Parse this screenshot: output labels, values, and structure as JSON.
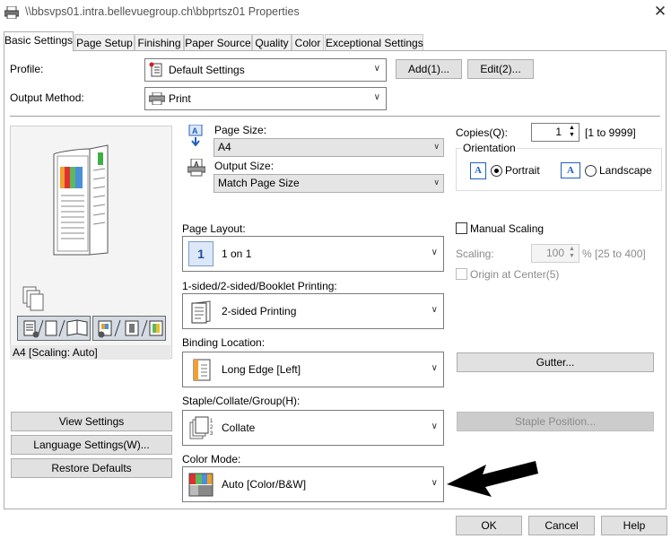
{
  "window": {
    "title": "\\\\bbsvps01.intra.bellevuegroup.ch\\bbprtsz01 Properties",
    "close_glyph": "✕"
  },
  "tabs": [
    {
      "label": "Basic Settings"
    },
    {
      "label": "Page Setup"
    },
    {
      "label": "Finishing"
    },
    {
      "label": "Paper Source"
    },
    {
      "label": "Quality"
    },
    {
      "label": "Color"
    },
    {
      "label": "Exceptional Settings"
    }
  ],
  "profile": {
    "label": "Profile:",
    "value": "Default Settings",
    "add_label": "Add(1)...",
    "edit_label": "Edit(2)..."
  },
  "output_method": {
    "label": "Output Method:",
    "value": "Print"
  },
  "preview": {
    "caption": "A4 [Scaling: Auto]"
  },
  "page_size": {
    "label": "Page Size:",
    "value": "A4"
  },
  "output_size": {
    "label": "Output Size:",
    "value": "Match Page Size"
  },
  "copies": {
    "label": "Copies(Q):",
    "value": "1",
    "range": "[1 to 9999]"
  },
  "orientation": {
    "group_label": "Orientation",
    "portrait_label": "Portrait",
    "landscape_label": "Landscape",
    "selected": "Portrait",
    "icon_letter": "A"
  },
  "page_layout": {
    "label": "Page Layout:",
    "value": "1 on 1",
    "icon_text": "1"
  },
  "manual_scaling": {
    "label": "Manual Scaling",
    "checked": false
  },
  "scaling": {
    "label": "Scaling:",
    "value": "100",
    "range": "% [25 to 400]"
  },
  "origin_center": {
    "label": "Origin at Center(5)",
    "checked": false
  },
  "sided": {
    "label": "1-sided/2-sided/Booklet Printing:",
    "value": "2-sided Printing"
  },
  "binding": {
    "label": "Binding Location:",
    "value": "Long Edge [Left]"
  },
  "gutter_label": "Gutter...",
  "staple": {
    "label": "Staple/Collate/Group(H):",
    "value": "Collate"
  },
  "staple_position_label": "Staple Position...",
  "color_mode": {
    "label": "Color Mode:",
    "value": "Auto [Color/B&W]"
  },
  "left_buttons": {
    "view": "View Settings",
    "language": "Language Settings(W)...",
    "restore": "Restore Defaults"
  },
  "footer": {
    "ok": "OK",
    "cancel": "Cancel",
    "help": "Help"
  },
  "colors": {
    "annotation_arrow": "#000000",
    "accent_blue": "#1f5fbf",
    "disabled_gray": "#8a8a8a"
  }
}
